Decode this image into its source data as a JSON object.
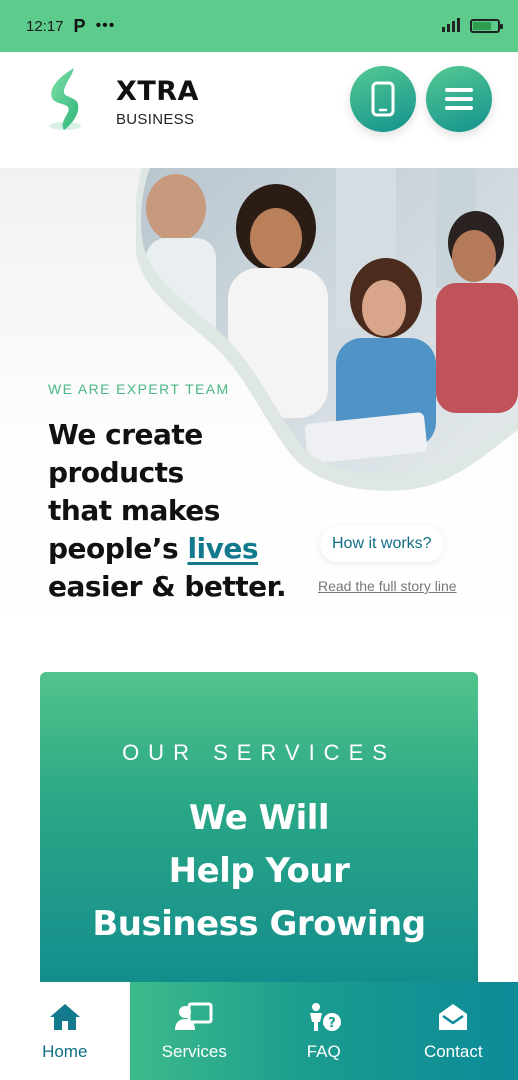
{
  "status_bar": {
    "time": "12:17",
    "app_icon": "P",
    "more": "•••"
  },
  "header": {
    "brand_name": "XTRA",
    "brand_sub": "BUSINESS",
    "icons": {
      "logo": "bolt-logo",
      "phone": "phone-icon",
      "menu": "hamburger-menu-icon"
    }
  },
  "hero": {
    "eyebrow": "WE ARE EXPERT TEAM",
    "headline_line1": "We create",
    "headline_line2": "products",
    "headline_line3": "that makes",
    "headline_line4_pre": "people’s ",
    "headline_highlight": "lives",
    "headline_line5": "easier & better.",
    "cta_label": "How it works?",
    "link_label": "Read the full story line"
  },
  "services": {
    "label": "OUR SERVICES",
    "title_line1": "We Will",
    "title_line2": "Help Your",
    "title_line3": "Business Growing"
  },
  "bottom_nav": {
    "items": [
      {
        "label": "Home",
        "icon": "home-icon"
      },
      {
        "label": "Services",
        "icon": "services-icon"
      },
      {
        "label": "FAQ",
        "icon": "faq-icon"
      },
      {
        "label": "Contact",
        "icon": "contact-icon"
      }
    ]
  },
  "colors": {
    "accent_green": "#5ccb8c",
    "accent_teal": "#118a8e",
    "link_blue": "#137a8e"
  }
}
